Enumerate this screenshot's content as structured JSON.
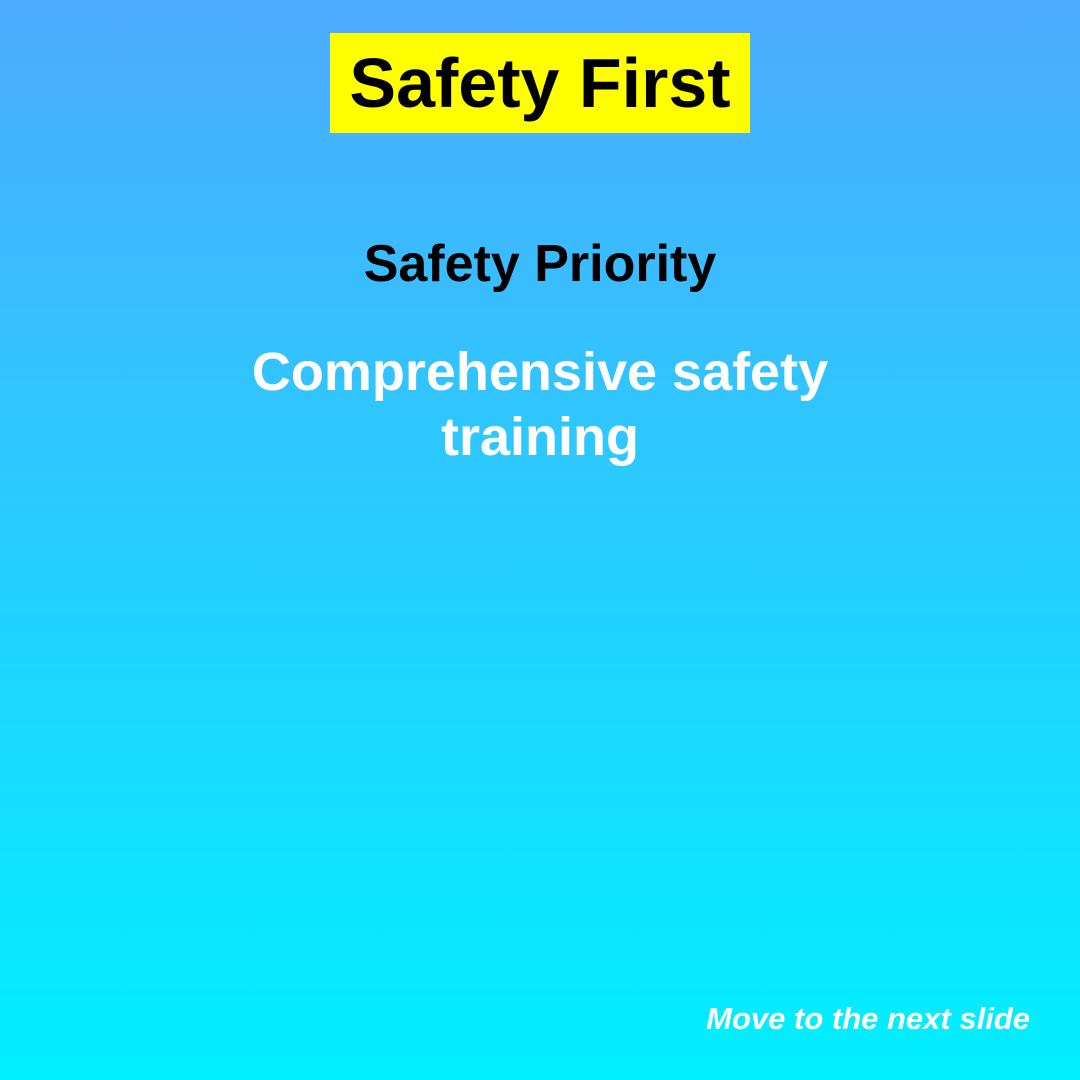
{
  "slide": {
    "title": "Safety First",
    "heading": "Safety Priority",
    "body": "Comprehensive safety training",
    "next_label": "Move to the next slide"
  },
  "colors": {
    "background_top": "#4dabff",
    "background_bottom": "#00f0ff",
    "title_box": "#ffff00",
    "title_text": "#000000",
    "heading_text": "#000000",
    "body_text": "#ffffff",
    "next_text": "#ffffff"
  }
}
